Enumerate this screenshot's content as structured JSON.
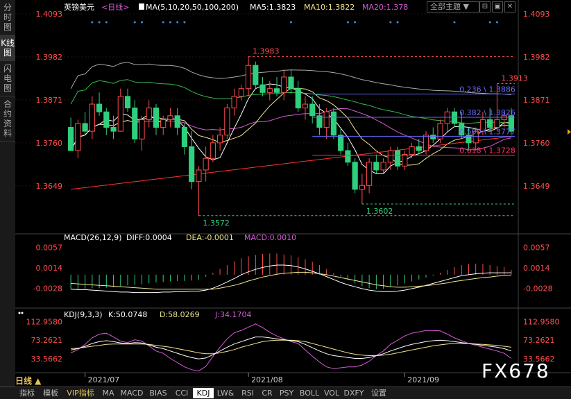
{
  "sidebar": {
    "items": [
      {
        "label": "分时图"
      },
      {
        "label": "K线图",
        "active": true
      },
      {
        "label": "闪电图"
      },
      {
        "label": "合约资料"
      }
    ]
  },
  "header": {
    "symbol": "英镑美元",
    "period": "<日线>",
    "ma_label": "MA(5,10,20,50,100,200)",
    "ma5": "MA5:1.3823",
    "ma10": "MA10:1.3822",
    "ma20": "MA20:1.378",
    "theme_btn": "全部主题",
    "theme_arrow": "▼",
    "win_buttons": [
      "⊟",
      "▣",
      "✕"
    ]
  },
  "colors": {
    "up": "#ff4d4d",
    "down": "#2ed07e",
    "ma5": "#ffffff",
    "ma10": "#f0e68c",
    "ma20": "#d65cd6",
    "ma50": "#38b84a",
    "ma100": "#aaaaaa",
    "ma200": "#ff3333",
    "fib": "#6a6aff",
    "fib618": "#ff3366"
  },
  "chart_data": [
    {
      "type": "candlestick",
      "yaxis_ticks": [
        "1.4093",
        "1.3982",
        "1.3871",
        "1.3760",
        "1.3649"
      ],
      "ylim": [
        1.3534,
        1.4093
      ],
      "annotations": [
        {
          "label": "1.3983",
          "kind": "high"
        },
        {
          "label": "1.3913",
          "kind": "high"
        },
        {
          "label": "1.3572",
          "kind": "low"
        },
        {
          "label": "1.3602",
          "kind": "low"
        }
      ],
      "fib_levels": [
        {
          "label": "0.236 \\ 1.3886",
          "value": 1.3886
        },
        {
          "label": "0.382 \\ 1.3826",
          "value": 1.3826
        },
        {
          "label": "0.500 \\ 1.3777",
          "value": 1.3777
        },
        {
          "label": "0.618 \\ 1.3728",
          "value": 1.3728
        }
      ],
      "xaxis_ticks": [
        "2021/07",
        "2021/08",
        "2021/09"
      ],
      "candles": [
        [
          1.38,
          1.3825,
          1.374,
          1.374
        ],
        [
          1.374,
          1.382,
          1.372,
          1.381
        ],
        [
          1.381,
          1.384,
          1.378,
          1.379
        ],
        [
          1.379,
          1.388,
          1.377,
          1.386
        ],
        [
          1.386,
          1.389,
          1.383,
          1.384
        ],
        [
          1.384,
          1.385,
          1.378,
          1.38
        ],
        [
          1.38,
          1.383,
          1.377,
          1.379
        ],
        [
          1.379,
          1.39,
          1.379,
          1.388
        ],
        [
          1.388,
          1.39,
          1.384,
          1.385
        ],
        [
          1.385,
          1.387,
          1.376,
          1.377
        ],
        [
          1.377,
          1.383,
          1.374,
          1.382
        ],
        [
          1.382,
          1.387,
          1.38,
          1.385
        ],
        [
          1.385,
          1.386,
          1.378,
          1.38
        ],
        [
          1.38,
          1.383,
          1.378,
          1.382
        ],
        [
          1.382,
          1.385,
          1.38,
          1.383
        ],
        [
          1.383,
          1.385,
          1.378,
          1.38
        ],
        [
          1.38,
          1.381,
          1.373,
          1.375
        ],
        [
          1.375,
          1.379,
          1.364,
          1.366
        ],
        [
          1.366,
          1.37,
          1.3572,
          1.369
        ],
        [
          1.369,
          1.375,
          1.366,
          1.372
        ],
        [
          1.372,
          1.378,
          1.371,
          1.376
        ],
        [
          1.376,
          1.38,
          1.374,
          1.378
        ],
        [
          1.378,
          1.386,
          1.377,
          1.385
        ],
        [
          1.385,
          1.39,
          1.383,
          1.388
        ],
        [
          1.388,
          1.391,
          1.387,
          1.39
        ],
        [
          1.39,
          1.3983,
          1.388,
          1.396
        ],
        [
          1.396,
          1.397,
          1.39,
          1.391
        ],
        [
          1.391,
          1.393,
          1.388,
          1.389
        ],
        [
          1.389,
          1.392,
          1.387,
          1.39
        ],
        [
          1.39,
          1.393,
          1.388,
          1.389
        ],
        [
          1.389,
          1.395,
          1.387,
          1.393
        ],
        [
          1.393,
          1.395,
          1.389,
          1.39
        ],
        [
          1.39,
          1.392,
          1.384,
          1.385
        ],
        [
          1.385,
          1.388,
          1.382,
          1.386
        ],
        [
          1.386,
          1.388,
          1.381,
          1.383
        ],
        [
          1.383,
          1.386,
          1.378,
          1.38
        ],
        [
          1.38,
          1.385,
          1.377,
          1.384
        ],
        [
          1.384,
          1.385,
          1.377,
          1.378
        ],
        [
          1.378,
          1.38,
          1.373,
          1.374
        ],
        [
          1.374,
          1.376,
          1.37,
          1.371
        ],
        [
          1.371,
          1.372,
          1.363,
          1.364
        ],
        [
          1.364,
          1.368,
          1.3602,
          1.365
        ],
        [
          1.365,
          1.372,
          1.363,
          1.371
        ],
        [
          1.371,
          1.373,
          1.368,
          1.369
        ],
        [
          1.369,
          1.372,
          1.368,
          1.371
        ],
        [
          1.371,
          1.375,
          1.369,
          1.374
        ],
        [
          1.374,
          1.375,
          1.369,
          1.37
        ],
        [
          1.37,
          1.374,
          1.369,
          1.373
        ],
        [
          1.373,
          1.376,
          1.372,
          1.375
        ],
        [
          1.375,
          1.377,
          1.373,
          1.374
        ],
        [
          1.374,
          1.379,
          1.373,
          1.378
        ],
        [
          1.378,
          1.38,
          1.376,
          1.377
        ],
        [
          1.377,
          1.382,
          1.376,
          1.381
        ],
        [
          1.381,
          1.385,
          1.379,
          1.384
        ],
        [
          1.384,
          1.385,
          1.38,
          1.381
        ],
        [
          1.381,
          1.384,
          1.377,
          1.378
        ],
        [
          1.378,
          1.38,
          1.374,
          1.376
        ],
        [
          1.376,
          1.38,
          1.374,
          1.379
        ],
        [
          1.379,
          1.384,
          1.378,
          1.382
        ],
        [
          1.382,
          1.385,
          1.379,
          1.38
        ],
        [
          1.38,
          1.3913,
          1.379,
          1.382
        ],
        [
          1.382,
          1.384,
          1.38,
          1.383
        ],
        [
          1.383,
          1.385,
          1.378,
          1.379
        ]
      ]
    },
    {
      "type": "bar",
      "title": "MACD(26,12,9)",
      "diff": "DIFF:0.0004",
      "dea": "DEA:-0.0001",
      "macd": "MACD:0.0010",
      "yaxis_ticks": [
        "0.0057",
        "0.0014",
        "-0.0028"
      ],
      "ylim": [
        -0.0052,
        0.0066
      ],
      "histogram": [
        -0.003,
        -0.003,
        -0.0029,
        -0.0028,
        -0.0028,
        -0.0027,
        -0.0026,
        -0.0024,
        -0.0022,
        -0.0021,
        -0.002,
        -0.0018,
        -0.0016,
        -0.0015,
        -0.0014,
        -0.0013,
        -0.0013,
        -0.0012,
        -0.001,
        -0.0004,
        0.0004,
        0.0012,
        0.002,
        0.0028,
        0.0034,
        0.0038,
        0.0041,
        0.0043,
        0.0044,
        0.0044,
        0.0042,
        0.004,
        0.0036,
        0.0032,
        0.0027,
        0.002,
        0.0012,
        0.0004,
        -0.0004,
        -0.0011,
        -0.0018,
        -0.0024,
        -0.0028,
        -0.003,
        -0.0029,
        -0.0026,
        -0.0022,
        -0.0018,
        -0.0014,
        -0.001,
        -0.0006,
        -0.0002,
        0.0004,
        0.001,
        0.0016,
        0.002,
        0.0022,
        0.0023,
        0.0022,
        0.002,
        0.0018,
        0.0016,
        0.001
      ],
      "diff_line": [
        -0.003,
        -0.0031,
        -0.0031,
        -0.0032,
        -0.0033,
        -0.0034,
        -0.0035,
        -0.0036,
        -0.0036,
        -0.0037,
        -0.0037,
        -0.0037,
        -0.0037,
        -0.0036,
        -0.0036,
        -0.0035,
        -0.0035,
        -0.0034,
        -0.0034,
        -0.0032,
        -0.0028,
        -0.0022,
        -0.0015,
        -0.0008,
        0.0,
        0.0006,
        0.0011,
        0.0015,
        0.0018,
        0.002,
        0.002,
        0.0019,
        0.0016,
        0.0012,
        0.0007,
        0.0002,
        -0.0004,
        -0.001,
        -0.0016,
        -0.0021,
        -0.0025,
        -0.0029,
        -0.0032,
        -0.0034,
        -0.0035,
        -0.0035,
        -0.0034,
        -0.0032,
        -0.0029,
        -0.0026,
        -0.0022,
        -0.0018,
        -0.0014,
        -0.001,
        -0.0006,
        -0.0002,
        0.0,
        0.0002,
        0.0003,
        0.0004,
        0.0004,
        0.0004,
        0.0004
      ],
      "dea_line": [
        -0.0018,
        -0.0019,
        -0.002,
        -0.0021,
        -0.0022,
        -0.0023,
        -0.0024,
        -0.0025,
        -0.0026,
        -0.0027,
        -0.0028,
        -0.0029,
        -0.003,
        -0.003,
        -0.003,
        -0.003,
        -0.003,
        -0.003,
        -0.003,
        -0.003,
        -0.003,
        -0.0028,
        -0.0025,
        -0.0022,
        -0.0018,
        -0.0013,
        -0.0009,
        -0.0005,
        -0.0002,
        0.0001,
        0.0003,
        0.0004,
        0.0005,
        0.0005,
        0.0004,
        0.0002,
        0.0,
        -0.0003,
        -0.0006,
        -0.0009,
        -0.0012,
        -0.0015,
        -0.0018,
        -0.0021,
        -0.0023,
        -0.0025,
        -0.0026,
        -0.0026,
        -0.0025,
        -0.0024,
        -0.0023,
        -0.0021,
        -0.0019,
        -0.0017,
        -0.0014,
        -0.0012,
        -0.001,
        -0.0008,
        -0.0006,
        -0.0005,
        -0.0003,
        -0.0002,
        -0.0001
      ]
    },
    {
      "type": "line",
      "title": "KDJ(9,3,3)",
      "k": "K:50.0748",
      "d": "D:58.0269",
      "j": "J:34.1704",
      "yaxis_ticks": [
        "112.9580",
        "73.2621",
        "33.5662"
      ],
      "ylim": [
        14,
        118
      ],
      "k_line": [
        52,
        55,
        60,
        66,
        70,
        72,
        70,
        67,
        66,
        68,
        67,
        63,
        58,
        55,
        50,
        45,
        40,
        36,
        33,
        35,
        42,
        50,
        58,
        65,
        70,
        75,
        80,
        80,
        78,
        76,
        74,
        72,
        70,
        64,
        57,
        50,
        44,
        40,
        38,
        36,
        34,
        34,
        36,
        40,
        44,
        50,
        55,
        60,
        64,
        67,
        70,
        72,
        73,
        72,
        70,
        68,
        66,
        64,
        62,
        60,
        58,
        55,
        50
      ],
      "d_line": [
        55,
        56,
        58,
        60,
        62,
        64,
        65,
        65,
        65,
        65,
        65,
        64,
        62,
        60,
        58,
        55,
        52,
        49,
        46,
        44,
        44,
        46,
        49,
        53,
        58,
        62,
        66,
        70,
        72,
        73,
        73,
        73,
        72,
        70,
        66,
        62,
        58,
        54,
        50,
        46,
        43,
        41,
        40,
        40,
        41,
        43,
        46,
        49,
        52,
        55,
        58,
        61,
        63,
        65,
        66,
        66,
        66,
        65,
        64,
        63,
        62,
        60,
        58
      ],
      "j_line": [
        46,
        53,
        64,
        78,
        86,
        88,
        80,
        71,
        68,
        74,
        71,
        61,
        50,
        45,
        34,
        25,
        16,
        10,
        7,
        17,
        38,
        58,
        76,
        89,
        94,
        101,
        108,
        100,
        90,
        82,
        76,
        70,
        66,
        52,
        39,
        26,
        16,
        12,
        14,
        16,
        16,
        20,
        28,
        40,
        50,
        64,
        73,
        82,
        88,
        91,
        94,
        94,
        93,
        86,
        78,
        72,
        66,
        62,
        58,
        54,
        50,
        45,
        34
      ]
    }
  ],
  "bottombar": {
    "day_btn": "日线 ▲",
    "tabs": [
      "指标",
      "模板",
      "VIP指标",
      "MA",
      "MACD",
      "BIAS",
      "CCI",
      "KDJ",
      "LW&",
      "RSI",
      "CR",
      "PSY",
      "BOLL",
      "VOL",
      "DXFY",
      "设置"
    ]
  },
  "watermark": "FX678"
}
